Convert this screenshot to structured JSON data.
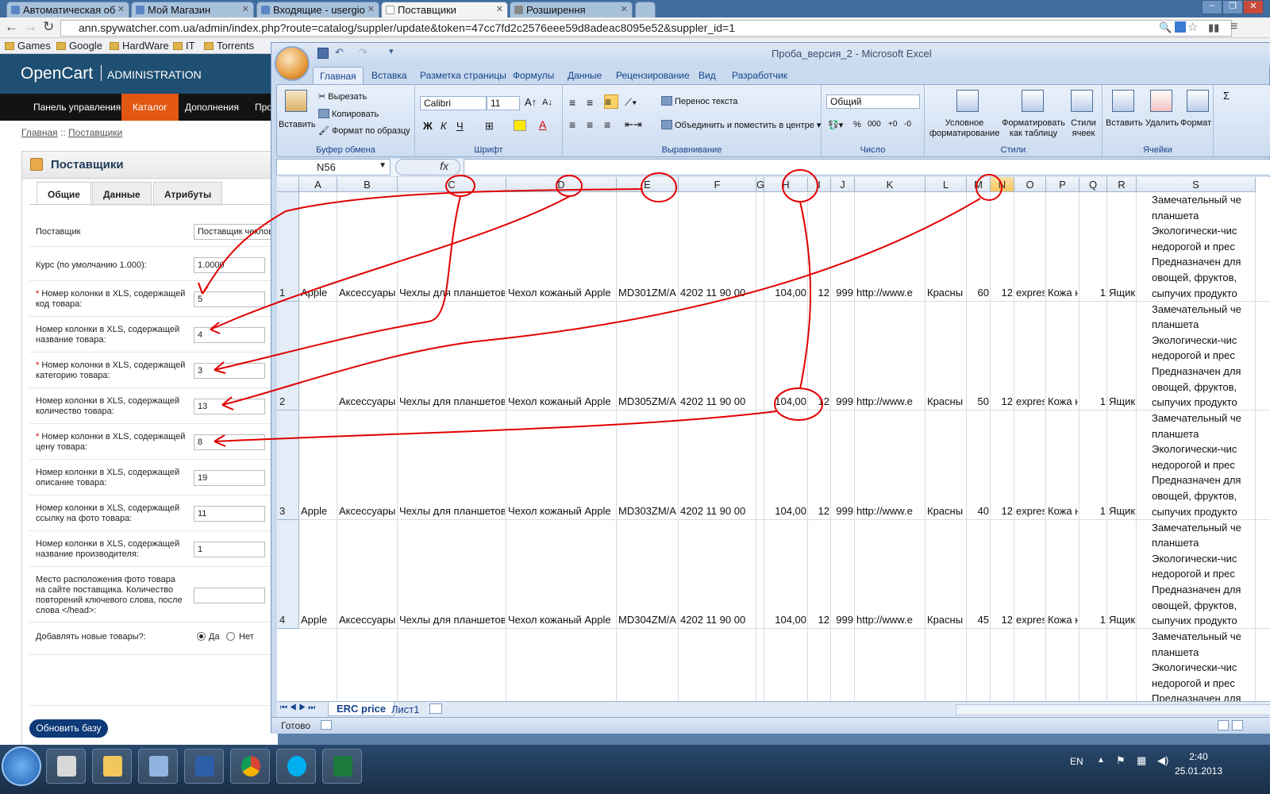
{
  "browser": {
    "tabs": [
      {
        "label": "Автоматическая об",
        "active": false
      },
      {
        "label": "Мой Магазин",
        "active": false
      },
      {
        "label": "Входящие - usergio",
        "active": false
      },
      {
        "label": "Поставщики",
        "active": true
      },
      {
        "label": "Розширення",
        "active": false
      }
    ],
    "url": "ann.spywatcher.com.ua/admin/index.php?route=catalog/suppler/update&token=47cc7fd2c2576eee59d8adeac8095e52&suppler_id=1",
    "bookmarks": [
      "Games",
      "Google",
      "HardWare",
      "IT",
      "Torrents"
    ]
  },
  "opencart": {
    "brand": "OpenCart",
    "brand_sub": "ADMINISTRATION",
    "menu": [
      "Панель управления",
      "Каталог",
      "Дополнения",
      "Про"
    ],
    "breadcrumb": [
      "Главная",
      "::",
      "Поставщики"
    ],
    "heading": "Поставщики",
    "tabs": [
      "Общие",
      "Данные",
      "Атрибуты"
    ],
    "fields": [
      {
        "label": "Поставщик",
        "value": "Поставщик чехлов",
        "required": false
      },
      {
        "label": "Курс (по умолчанию 1.000):",
        "value": "1.0000",
        "required": false
      },
      {
        "label": "Номер колонки в XLS, содержащей код товара:",
        "value": "5",
        "required": true
      },
      {
        "label": "Номер колонки в XLS, содержащей название товара:",
        "value": "4",
        "required": false
      },
      {
        "label": "Номер колонки в XLS, содержащей категорию товара:",
        "value": "3",
        "required": true
      },
      {
        "label": "Номер колонки в XLS, содержащей количество товара:",
        "value": "13",
        "required": false
      },
      {
        "label": "Номер колонки в XLS, содержащей цену товара:",
        "value": "8",
        "required": true
      },
      {
        "label": "Номер колонки в XLS, содержащей описание товара:",
        "value": "19",
        "required": false
      },
      {
        "label": "Номер колонки в XLS, содержащей ссылку на фото товара:",
        "value": "11",
        "required": false
      },
      {
        "label": "Номер колонки в XLS, содержащей название производителя:",
        "value": "1",
        "required": false
      },
      {
        "label": "Место расположения фото товара на сайте поставщика. Количество повторений ключевого слова, после слова </head>:",
        "value": "",
        "required": false
      }
    ],
    "add_new_label": "Добавлять новые товары?:",
    "add_new_yes": "Да",
    "add_new_no": "Нет",
    "add_new_selected": "Да",
    "submit": "Обновить базу",
    "required_mark": "*"
  },
  "excel": {
    "title": "Проба_версия_2 - Microsoft Excel",
    "ribbon_tabs": [
      "Главная",
      "Вставка",
      "Разметка страницы",
      "Формулы",
      "Данные",
      "Рецензирование",
      "Вид",
      "Разработчик"
    ],
    "clipboard": {
      "paste": "Вставить",
      "cut": "Вырезать",
      "copy": "Копировать",
      "format_painter": "Формат по образцу",
      "label": "Буфер обмена"
    },
    "font": {
      "name": "Calibri",
      "size": "11",
      "label": "Шрифт",
      "bold": "Ж",
      "italic": "К",
      "underline": "Ч"
    },
    "alignment": {
      "wrap": "Перенос текста",
      "merge": "Объединить и поместить в центре",
      "label": "Выравнивание"
    },
    "number": {
      "format": "Общий",
      "label": "Число",
      "percent": "%",
      "thousands": "000"
    },
    "styles": {
      "conditional": "Условное форматирование",
      "as_table": "Форматировать как таблицу",
      "cell_styles": "Стили ячеек",
      "label": "Стили"
    },
    "cells": {
      "insert": "Вставить",
      "delete": "Удалить",
      "format": "Формат",
      "label": "Ячейки"
    },
    "name_box": "N56",
    "fx": "fx",
    "columns": [
      "A",
      "B",
      "C",
      "D",
      "E",
      "F",
      "G",
      "H",
      "I",
      "J",
      "K",
      "L",
      "M",
      "N",
      "O",
      "P",
      "Q",
      "R",
      "S"
    ],
    "highlighted_column": "N",
    "rows": [
      {
        "num": "1",
        "A": "Apple",
        "B": "Аксессуары",
        "C": "Чехлы для планшетов",
        "D": "Чехол кожаный Apple",
        "E": "MD301ZM/A (",
        "F": "4202 11 90 00",
        "H": "104,00",
        "I": "12",
        "J": "999",
        "K": "http://www.e",
        "L": "Красны",
        "M": "60",
        "N": "12",
        "O": "expres",
        "P": "Кожа н",
        "Q": "1",
        "R": "Ящик"
      },
      {
        "num": "2",
        "A": "",
        "B": "Аксессуары",
        "C": "Чехлы для планшетов",
        "D": "Чехол кожаный Apple",
        "E": "MD305ZM/A (",
        "F": "4202 11 90 00",
        "H": "104,00",
        "I": "12",
        "J": "999",
        "K": "http://www.e",
        "L": "Красны",
        "M": "50",
        "N": "12",
        "O": "expres",
        "P": "Кожа н",
        "Q": "1",
        "R": "Ящик"
      },
      {
        "num": "3",
        "A": "Apple",
        "B": "Аксессуары",
        "C": "Чехлы для планшетов",
        "D": "Чехол кожаный Apple",
        "E": "MD303ZM/A (",
        "F": "4202 11 90 00",
        "H": "104,00",
        "I": "12",
        "J": "999",
        "K": "http://www.e",
        "L": "Красны",
        "M": "40",
        "N": "12",
        "O": "expres",
        "P": "Кожа н",
        "Q": "1",
        "R": "Ящик"
      },
      {
        "num": "4",
        "A": "Apple",
        "B": "Аксессуары",
        "C": "Чехлы для планшетов",
        "D": "Чехол кожаный Apple",
        "E": "MD304ZM/A (",
        "F": "4202 11 90 00",
        "H": "104,00",
        "I": "12",
        "J": "999",
        "K": "http://www.e",
        "L": "Красны",
        "M": "45",
        "N": "12",
        "O": "expres",
        "P": "Кожа н",
        "Q": "1",
        "R": "Ящик"
      }
    ],
    "s_text": [
      "Замечательный че",
      "планшета",
      "Экологически-чис",
      "недорогой и прес",
      "Предназначен для",
      "овощей, фруктов,",
      "сыпучих продукто"
    ],
    "sheets": [
      "ERC price",
      "Лист1"
    ],
    "status": "Готово"
  },
  "taskbar": {
    "lang": "EN",
    "time": "2:40",
    "date": "25.01.2013"
  },
  "annotation_color": "#e00000"
}
